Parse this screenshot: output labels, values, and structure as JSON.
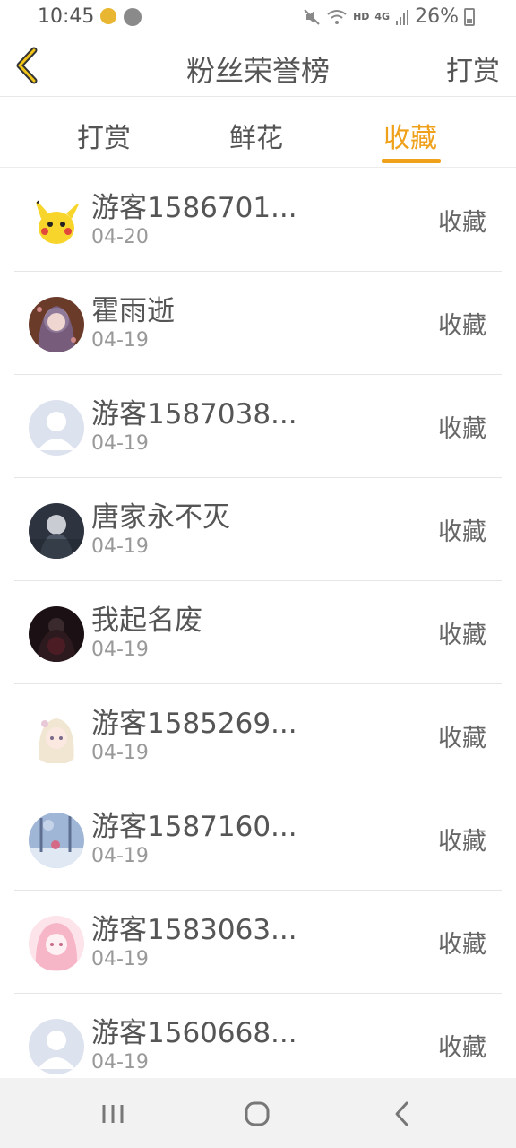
{
  "status_bar": {
    "time": "10:45",
    "hd_label": "HD",
    "network_label": "4G",
    "battery_percent": "26%"
  },
  "header": {
    "title": "粉丝荣誉榜",
    "action_label": "打赏"
  },
  "tabs": [
    {
      "label": "打赏",
      "active": false
    },
    {
      "label": "鲜花",
      "active": false
    },
    {
      "label": "收藏",
      "active": true
    }
  ],
  "colors": {
    "accent": "#f0a11b",
    "text": "#555555",
    "subtext": "#999999"
  },
  "fans": [
    {
      "name": "游客1586701...",
      "date": "04-20",
      "action": "收藏",
      "avatar_icon": "pikachu-avatar"
    },
    {
      "name": "霍雨逝",
      "date": "04-19",
      "action": "收藏",
      "avatar_icon": "anime-girl-avatar"
    },
    {
      "name": "游客1587038...",
      "date": "04-19",
      "action": "收藏",
      "avatar_icon": "default-user-avatar"
    },
    {
      "name": "唐家永不灭",
      "date": "04-19",
      "action": "收藏",
      "avatar_icon": "dark-character-avatar"
    },
    {
      "name": "我起名废",
      "date": "04-19",
      "action": "收藏",
      "avatar_icon": "dark-cloak-avatar"
    },
    {
      "name": "游客1585269...",
      "date": "04-19",
      "action": "收藏",
      "avatar_icon": "white-hair-girl-avatar"
    },
    {
      "name": "游客1587160...",
      "date": "04-19",
      "action": "收藏",
      "avatar_icon": "winter-scene-avatar"
    },
    {
      "name": "游客1583063...",
      "date": "04-19",
      "action": "收藏",
      "avatar_icon": "pink-girl-avatar"
    },
    {
      "name": "游客1560668...",
      "date": "04-19",
      "action": "收藏",
      "avatar_icon": "default-user-avatar"
    }
  ],
  "nav": {
    "recent_icon": "recent-apps-icon",
    "home_icon": "home-icon",
    "back_icon": "back-icon"
  }
}
